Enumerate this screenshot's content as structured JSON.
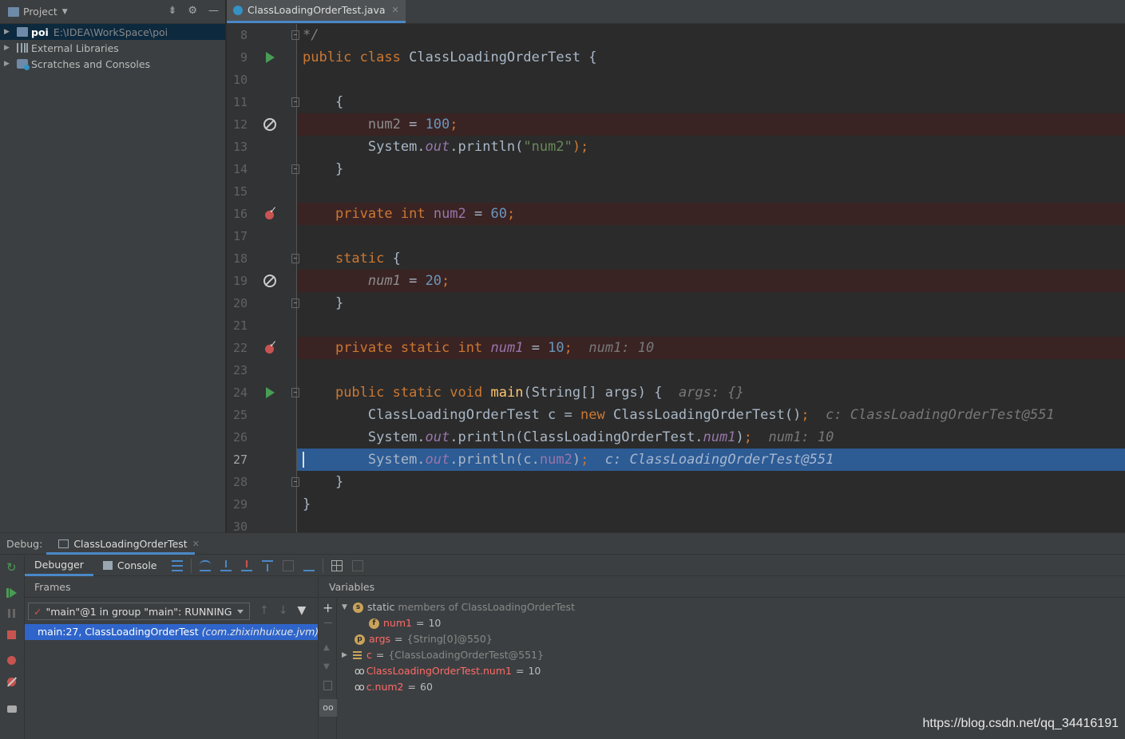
{
  "project": {
    "title": "Project",
    "tree": [
      {
        "bold": "poi",
        "label": "",
        "path": "E:\\IDEA\\WorkSpace\\poi"
      },
      {
        "bold": "",
        "label": "External Libraries",
        "path": ""
      },
      {
        "bold": "",
        "label": "Scratches and Consoles",
        "path": ""
      }
    ]
  },
  "editor": {
    "tab": {
      "label": "ClassLoadingOrderTest.java"
    },
    "lines": {
      "l8": {
        "num": "8",
        "t1": "*/"
      },
      "l9": {
        "num": "9",
        "t1": "public",
        "t2": "class",
        "t3": "ClassLoadingOrderTest {"
      },
      "l10": {
        "num": "10"
      },
      "l11": {
        "num": "11",
        "t1": "{"
      },
      "l12": {
        "num": "12",
        "t1": "num2",
        "t2": " = ",
        "t3": "100",
        "t4": ";"
      },
      "l13": {
        "num": "13",
        "t1": "System.",
        "t2": "out",
        "t3": ".println(",
        "t4": "\"num2\"",
        "t5": ");"
      },
      "l14": {
        "num": "14",
        "t1": "}"
      },
      "l15": {
        "num": "15"
      },
      "l16": {
        "num": "16",
        "t1": "private",
        "t2": "int",
        "t3": "num2",
        "t4": " = ",
        "t5": "60",
        "t6": ";"
      },
      "l17": {
        "num": "17"
      },
      "l18": {
        "num": "18",
        "t1": "static",
        "t2": " {"
      },
      "l19": {
        "num": "19",
        "t1": "num1",
        "t2": " = ",
        "t3": "20",
        "t4": ";"
      },
      "l20": {
        "num": "20",
        "t1": "}"
      },
      "l21": {
        "num": "21"
      },
      "l22": {
        "num": "22",
        "t1": "private",
        "t2": "static",
        "t3": "int",
        "t4": "num1",
        "t5": " = ",
        "t6": "10",
        "t7": ";",
        "hint": "num1: 10"
      },
      "l23": {
        "num": "23"
      },
      "l24": {
        "num": "24",
        "t1": "public",
        "t2": "static",
        "t3": "void",
        "t4": "main",
        "t5": "(String[] args) {",
        "hint": "args: {}"
      },
      "l25": {
        "num": "25",
        "t1": "ClassLoadingOrderTest c = ",
        "t2": "new",
        "t3": " ClassLoadingOrderTest()",
        "t4": ";",
        "hint": "c: ClassLoadingOrderTest@551"
      },
      "l26": {
        "num": "26",
        "t1": "System.",
        "t2": "out",
        "t3": ".println(ClassLoadingOrderTest.",
        "t4": "num1",
        "t5": ")",
        "t6": ";",
        "hint": "num1: 10"
      },
      "l27": {
        "num": "27",
        "t1": "System.",
        "t2": "out",
        "t3": ".println(c.",
        "t4": "num2",
        "t5": ")",
        "t6": ";",
        "hint": "c: ClassLoadingOrderTest@551"
      },
      "l28": {
        "num": "28",
        "t1": "}"
      },
      "l29": {
        "num": "29",
        "t1": "}"
      },
      "l30": {
        "num": "30"
      }
    }
  },
  "debug": {
    "label": "Debug:",
    "session_tab": "ClassLoadingOrderTest",
    "debugger_tab": "Debugger",
    "console_tab": "Console",
    "frames_title": "Frames",
    "thread": "\"main\"@1 in group \"main\": RUNNING",
    "frame": {
      "location": "main:27, ClassLoadingOrderTest",
      "package": "(com.zhixinhuixue.jvm)"
    },
    "variables_title": "Variables",
    "variables": [
      {
        "name": "static",
        "rest": "members of ClassLoadingOrderTest"
      },
      {
        "name": "num1",
        "eq": "=",
        "value": "10"
      },
      {
        "name": "args",
        "eq": "=",
        "value": "{String[0]@550}"
      },
      {
        "name": "c",
        "eq": "=",
        "value": "{ClassLoadingOrderTest@551}"
      },
      {
        "name": "ClassLoadingOrderTest.num1",
        "eq": "=",
        "value": "10"
      },
      {
        "name": "c.num2",
        "eq": "=",
        "value": "60"
      }
    ]
  },
  "watermark": "https://blog.csdn.net/qq_34416191",
  "colors": {
    "keyword": "#cc7832",
    "number": "#6897bb",
    "string": "#6a8759",
    "field": "#9876aa",
    "selection": "#2d5b94",
    "breakpoint_line": "#3a2323"
  }
}
